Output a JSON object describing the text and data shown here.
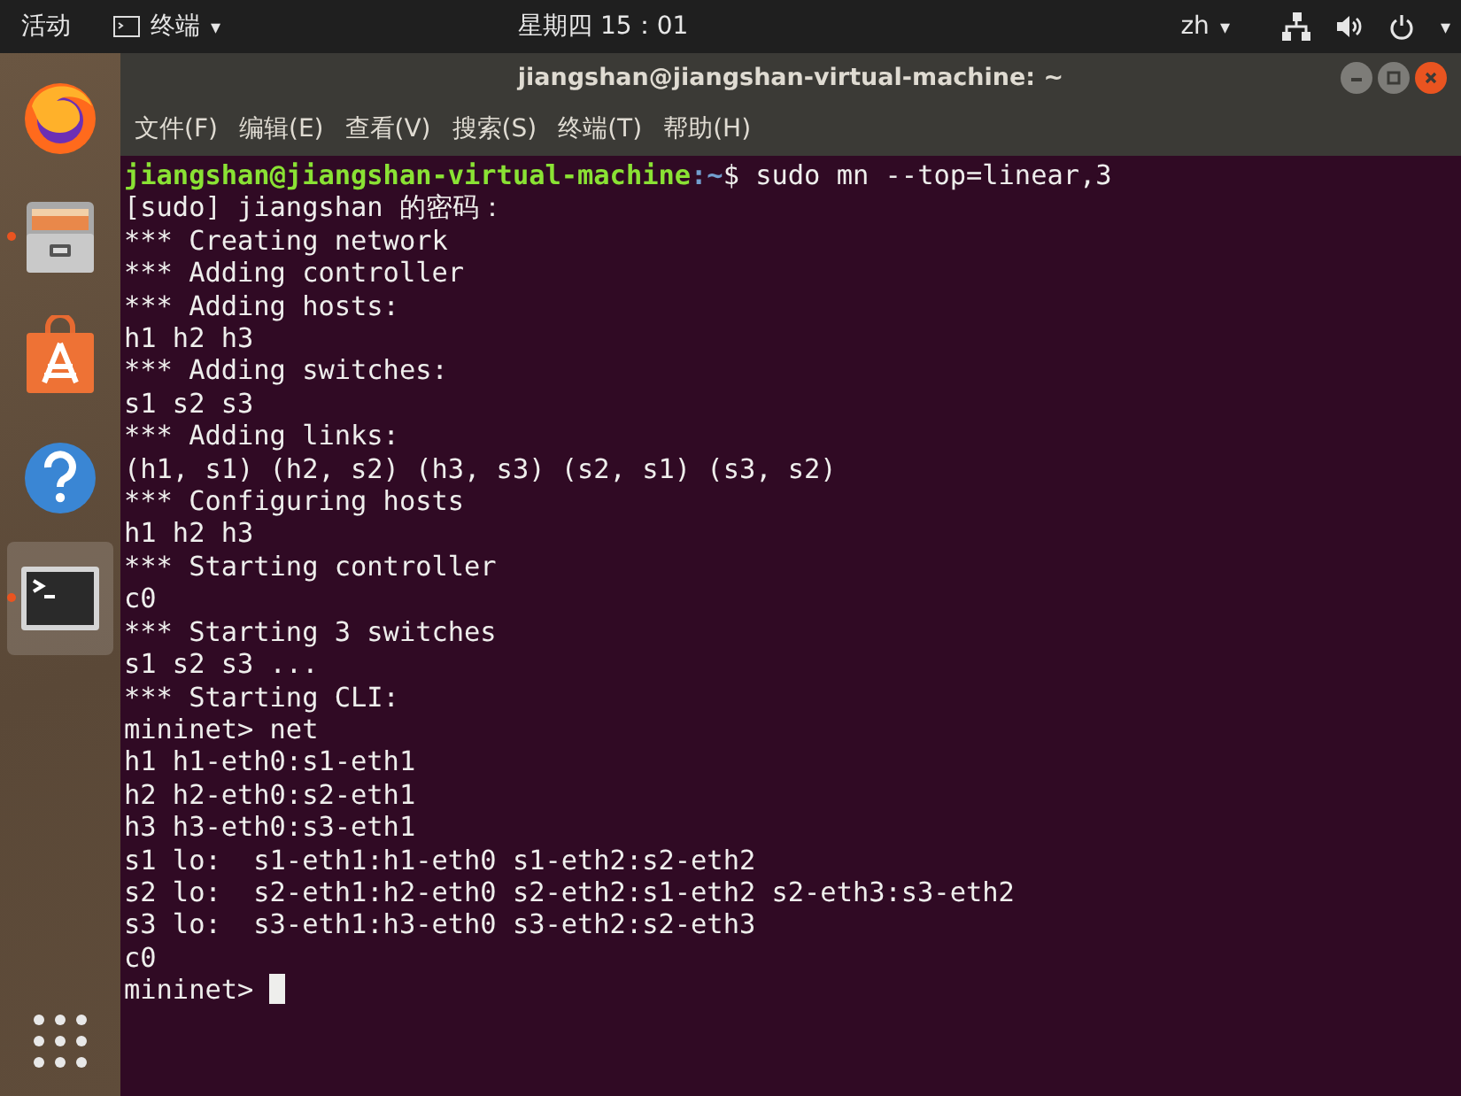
{
  "top_bar": {
    "activities": "活动",
    "app_menu": {
      "label": "终端",
      "caret": "▾"
    },
    "clock": "星期四 15：01",
    "input_method": {
      "label": "zh",
      "caret": "▾"
    },
    "system_caret": "▾"
  },
  "dock": {
    "items": [
      {
        "kind": "browser",
        "running": false,
        "selected": false
      },
      {
        "kind": "files",
        "running": true,
        "selected": false
      },
      {
        "kind": "store",
        "running": false,
        "selected": false
      },
      {
        "kind": "help",
        "running": false,
        "selected": false
      },
      {
        "kind": "terminal",
        "running": true,
        "selected": true
      }
    ]
  },
  "window": {
    "title": "jiangshan@jiangshan-virtual-machine: ~",
    "menu": [
      "文件(F)",
      "编辑(E)",
      "查看(V)",
      "搜索(S)",
      "终端(T)",
      "帮助(H)"
    ],
    "lines": [
      {
        "kind": "prompt",
        "user_host": "jiangshan@jiangshan-virtual-machine",
        "path": ":~",
        "symbol": "$",
        "command": "sudo mn --top=linear,3"
      },
      {
        "kind": "output",
        "text": "[sudo] jiangshan 的密码："
      },
      {
        "kind": "output",
        "text": "*** Creating network"
      },
      {
        "kind": "output",
        "text": "*** Adding controller"
      },
      {
        "kind": "output",
        "text": "*** Adding hosts:"
      },
      {
        "kind": "output",
        "text": "h1 h2 h3"
      },
      {
        "kind": "output",
        "text": "*** Adding switches:"
      },
      {
        "kind": "output",
        "text": "s1 s2 s3"
      },
      {
        "kind": "output",
        "text": "*** Adding links:"
      },
      {
        "kind": "output",
        "text": "(h1, s1) (h2, s2) (h3, s3) (s2, s1) (s3, s2)"
      },
      {
        "kind": "output",
        "text": "*** Configuring hosts"
      },
      {
        "kind": "output",
        "text": "h1 h2 h3"
      },
      {
        "kind": "output",
        "text": "*** Starting controller"
      },
      {
        "kind": "output",
        "text": "c0"
      },
      {
        "kind": "output",
        "text": "*** Starting 3 switches"
      },
      {
        "kind": "output",
        "text": "s1 s2 s3 ..."
      },
      {
        "kind": "output",
        "text": "*** Starting CLI:"
      },
      {
        "kind": "output",
        "text": "mininet> net"
      },
      {
        "kind": "output",
        "text": "h1 h1-eth0:s1-eth1"
      },
      {
        "kind": "output",
        "text": "h2 h2-eth0:s2-eth1"
      },
      {
        "kind": "output",
        "text": "h3 h3-eth0:s3-eth1"
      },
      {
        "kind": "output",
        "text": "s1 lo:  s1-eth1:h1-eth0 s1-eth2:s2-eth2"
      },
      {
        "kind": "output",
        "text": "s2 lo:  s2-eth1:h2-eth0 s2-eth2:s1-eth2 s2-eth3:s3-eth2"
      },
      {
        "kind": "output",
        "text": "s3 lo:  s3-eth1:h3-eth0 s3-eth2:s2-eth3"
      },
      {
        "kind": "output",
        "text": "c0"
      },
      {
        "kind": "input",
        "text": "mininet>",
        "cursor": true
      }
    ]
  }
}
